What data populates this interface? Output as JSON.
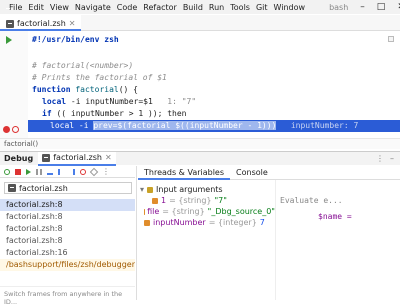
{
  "menubar": {
    "items": [
      "File",
      "Edit",
      "View",
      "Navigate",
      "Code",
      "Refactor",
      "Build",
      "Run",
      "Tools",
      "Git",
      "Window"
    ],
    "title": "bash"
  },
  "editor_tab": {
    "label": "factorial.zsh"
  },
  "code": {
    "line1": "#!/usr/bin/env zsh",
    "line2": "# factorial(<number>)",
    "line3": "# Prints the factorial of $1",
    "line4_kw": "function",
    "line4_fn": "factorial",
    "line4_rest": "() {",
    "line5_kw": "local",
    "line5_rest": " -i inputNumber=$1",
    "line5_inline": "1: \"7\"",
    "line6_kw": "if",
    "line6_rest": " (( inputNumber > 1 )); then",
    "line7_pre": "local -i ",
    "line7_cur": "prev=$(factorial $((inputNumber - 1)))",
    "line7_inline": "inputNumber: 7"
  },
  "breadcrumb": "factorial()",
  "debug": {
    "title": "Debug",
    "tab": "factorial.zsh",
    "thread": "factorial.zsh",
    "frames": [
      "factorial.zsh:8",
      "factorial.zsh:8",
      "factorial.zsh:8",
      "factorial.zsh:8",
      "factorial.zsh:16",
      "/bashsupport/files/zsh/debugger/fa"
    ],
    "hint": "Switch frames from anywhere in the ID...",
    "tabs": [
      "Threads & Variables",
      "Console"
    ],
    "vars": {
      "group": "Input arguments",
      "arg1_name": "1",
      "arg1_type": "= {string}",
      "arg1_val": "\"7\"",
      "file_name": "file",
      "file_type": "= {string}",
      "file_val": "\"_Dbg_source_0\"",
      "in_name": "inputNumber",
      "in_type": "= {integer}",
      "in_val": "7"
    },
    "eval_placeholder": "Evaluate e...",
    "watch": "$name ="
  },
  "colors": {
    "accent": "#4a7ee8",
    "current_line": "#2b5cd6",
    "breakpoint": "#dd3333"
  }
}
